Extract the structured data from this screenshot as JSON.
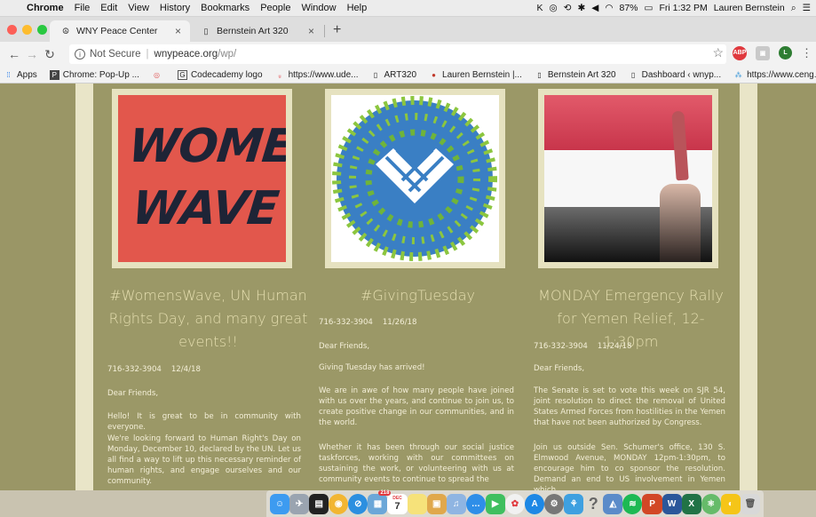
{
  "menubar": {
    "app_name": "Chrome",
    "items": [
      "File",
      "Edit",
      "View",
      "History",
      "Bookmarks",
      "People",
      "Window",
      "Help"
    ],
    "battery": "87%",
    "clock": "Fri 1:32 PM",
    "user": "Lauren Bernstein"
  },
  "tabs": [
    {
      "title": "WNY Peace Center",
      "icon": "peace-icon",
      "active": true
    },
    {
      "title": "Bernstein Art 320",
      "icon": "doc-icon",
      "active": false
    }
  ],
  "address": {
    "security": "Not Secure",
    "domain": "wnypeace.org",
    "path": "/wp/"
  },
  "bookmarks": [
    {
      "label": "Apps",
      "icon": "apps-grid-icon"
    },
    {
      "label": "Chrome: Pop-Up ...",
      "icon": "p-icon"
    },
    {
      "label": "",
      "icon": "circle-icon"
    },
    {
      "label": "Codecademy logo",
      "icon": "doc-icon"
    },
    {
      "label": "https://www.ude...",
      "icon": "udemy-icon"
    },
    {
      "label": "ART320",
      "icon": "doc-icon"
    },
    {
      "label": "Lauren Bernstein |...",
      "icon": "dot-icon"
    },
    {
      "label": "Bernstein Art 320",
      "icon": "doc-icon"
    },
    {
      "label": "Dashboard ‹ wnyp...",
      "icon": "doc-icon"
    },
    {
      "label": "https://www.ceng...",
      "icon": "sparkle-icon"
    }
  ],
  "posts": [
    {
      "image_text_line1": "WOMEI",
      "image_text_line2": "WAVE",
      "title": "#WomensWave, UN Human Rights Day, and many great events!!",
      "phone": "716-332-3904",
      "date": "12/4/18",
      "greeting": "Dear Friends,",
      "p1": "Hello! It is great to be in community with everyone.",
      "p2": "We're looking forward to Human Right's Day on Monday, December 10, declared by the UN. Let us all find a way to lift up this necessary reminder of human rights, and engage ourselves and our community."
    },
    {
      "title": "#GivingTuesday",
      "phone": "716-332-3904",
      "date": "11/26/18",
      "greeting": "Dear Friends,",
      "p1": "Giving Tuesday has arrived!",
      "p2": "We are in awe of how many people have joined with us over the years, and continue to join us, to create positive change in our communities, and in the world.",
      "p3": "Whether it has been through our social justice taskforces, working with our committees on sustaining the work, or volunteering with us at community events to continue to spread the"
    },
    {
      "title": "MONDAY Emergency Rally for Yemen Relief, 12-1:30pm",
      "phone": "716-332-3904",
      "date": "11/24/18",
      "greeting": "Dear Friends,",
      "p1": "The Senate is set to vote this week on SJR 54, joint resolution to direct the removal of United States Armed Forces from hostilities in the Yemen that have not been authorized by Congress.",
      "p2": "Join us outside Sen. Schumer's office, 130 S. Elmwood Avenue, MONDAY 12pm-1:30pm, to encourage him to co sponsor the resolution. Demand an end to US involvement in Yemen which"
    }
  ],
  "dock": {
    "badges": {
      "mail": "218",
      "calendar_month": "DEC",
      "calendar_day": "7"
    },
    "apps": [
      "finder-icon",
      "launchpad-icon",
      "terminal-icon",
      "chrome-icon",
      "safari-icon",
      "preview-icon",
      "calendar-icon",
      "notes-icon",
      "reminders-icon",
      "itunes-icon",
      "messages-icon",
      "facetime-icon",
      "photos-icon",
      "appstore-icon",
      "system-prefs-icon",
      "sharing-icon",
      "help-icon",
      "steam-icon",
      "spotify-icon",
      "powerpoint-icon",
      "word-icon",
      "excel-icon",
      "atom-icon",
      "cyberduck-icon",
      "trash-icon"
    ]
  },
  "colors": {
    "page_bg": "#9a9666",
    "frame": "#e9e5c8",
    "title": "#e6dfb0",
    "text": "#f4efd8"
  }
}
